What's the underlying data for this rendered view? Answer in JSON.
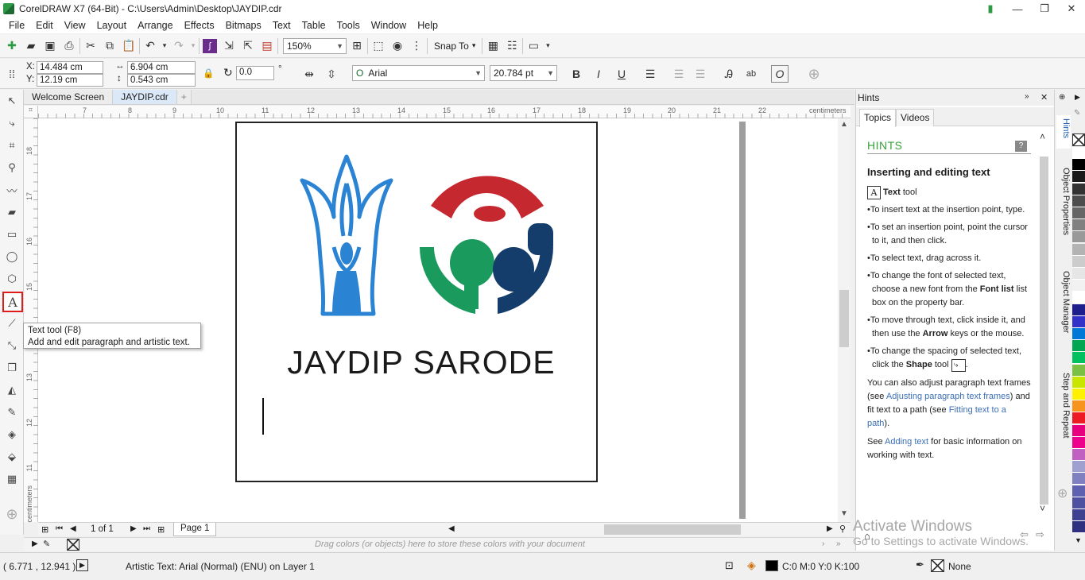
{
  "window": {
    "title": "CorelDRAW X7 (64-Bit) - C:\\Users\\Admin\\Desktop\\JAYDIP.cdr"
  },
  "menu": [
    "File",
    "Edit",
    "View",
    "Layout",
    "Arrange",
    "Effects",
    "Bitmaps",
    "Text",
    "Table",
    "Tools",
    "Window",
    "Help"
  ],
  "toolbar": {
    "zoom": "150%",
    "snap_to": "Snap To"
  },
  "properties": {
    "x_label": "X:",
    "x": "14.484 cm",
    "y_label": "Y:",
    "y": "12.19 cm",
    "width": "6.904 cm",
    "height": "0.543 cm",
    "rotation": "0.0",
    "degree": "°",
    "font": "Arial",
    "font_size": "20.784 pt"
  },
  "tabs": [
    "Welcome Screen",
    "JAYDIP.cdr"
  ],
  "ruler": {
    "h_labels": [
      "7",
      "8",
      "9",
      "10",
      "11",
      "12",
      "13",
      "14",
      "15",
      "16",
      "17",
      "18",
      "19",
      "20",
      "21",
      "22"
    ],
    "units": "centimeters",
    "v_labels": [
      "18",
      "17",
      "16",
      "15",
      "14",
      "13",
      "12",
      "11"
    ]
  },
  "canvas": {
    "text": "JAYDIP SARODE"
  },
  "tooltip": {
    "title": "Text tool (F8)",
    "desc": "Add and edit paragraph and artistic text."
  },
  "page_nav": {
    "counter": "1 of 1",
    "page_tab": "Page 1"
  },
  "tray": {
    "hint": "Drag colors (or objects) here to store these colors with your document"
  },
  "status": {
    "coords": "( 6.771 , 12.941 )",
    "object": "Artistic Text: Arial (Normal) (ENU) on Layer 1",
    "fill": "C:0 M:0 Y:0 K:100",
    "outline": "None"
  },
  "hints": {
    "panel_title": "Hints",
    "tab_topics": "Topics",
    "tab_videos": "Videos",
    "heading": "HINTS",
    "subtitle": "Inserting and editing text",
    "tool_name": "Text",
    "tool_word": "tool",
    "b1": "To insert text at the insertion point, type.",
    "b2": "To set an insertion point, point the cursor to it, and then click.",
    "b3": "To select text, drag across it.",
    "b4_pre": "To change the font of selected text, choose a new font from the ",
    "b4_bold": "Font list",
    "b4_post": " list box on the property bar.",
    "b5_pre": "To move through text, click inside it, and then use the ",
    "b5_bold": "Arrow",
    "b5_post": " keys or the mouse.",
    "b6_pre": "To change the spacing of selected text, click the ",
    "b6_bold": "Shape",
    "b6_post": " tool",
    "p1_pre": "You can also adjust paragraph text frames (see ",
    "p1_link1": "Adjusting paragraph text frames",
    "p1_mid": ") and fit text to a path (see ",
    "p1_link2": "Fitting text to a path",
    "p1_post": ").",
    "p2_pre": "See ",
    "p2_link": "Adding text",
    "p2_post": " for basic information on working with text."
  },
  "side_tabs": [
    "Hints",
    "Object Properties",
    "Object Manager",
    "Step and Repeat"
  ],
  "watermark": {
    "line1": "Activate Windows",
    "line2": "Go to Settings to activate Windows."
  },
  "palette_colors": [
    "#ffffff",
    "#000000",
    "#1a1a1a",
    "#333333",
    "#4d4d4d",
    "#666666",
    "#808080",
    "#999999",
    "#b3b3b3",
    "#cccccc",
    "#e6e6e6",
    "#f2f2f2",
    "#ffffff",
    "#1e1e8c",
    "#3232c8",
    "#0078d7",
    "#00a651",
    "#00c060",
    "#7ac143",
    "#c8e600",
    "#fff200",
    "#f7941d",
    "#ed1c24",
    "#e6007e",
    "#ec008c",
    "#c060c0",
    "#a0a0d0",
    "#8080c0",
    "#6060b0",
    "#5050a0",
    "#404090",
    "#303080"
  ]
}
